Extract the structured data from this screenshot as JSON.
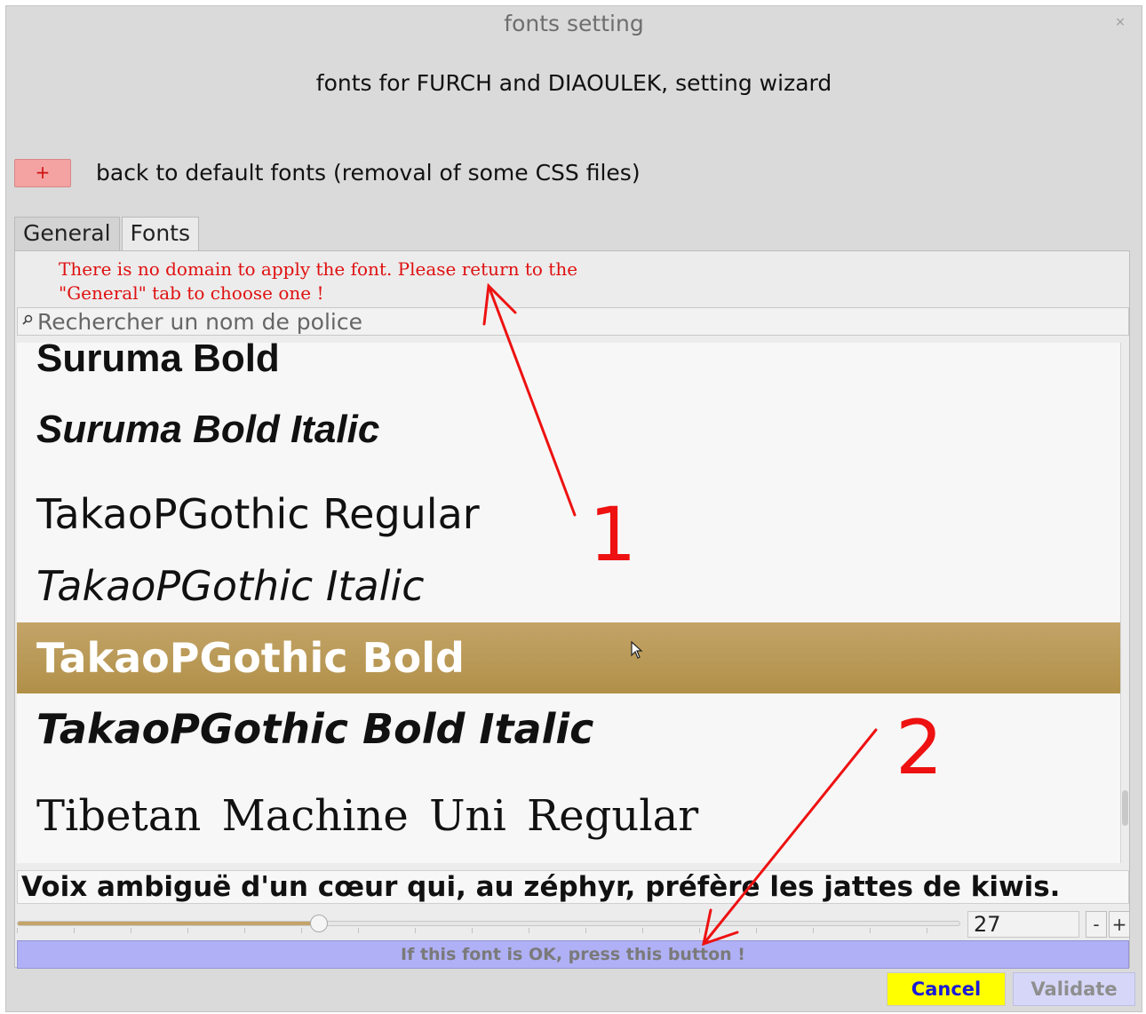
{
  "window": {
    "title": "fonts setting",
    "close_glyph": "×"
  },
  "wizard_heading": "fonts for FURCH and DIAOULEK, setting wizard",
  "reset": {
    "button_glyph": "+",
    "label": "back to default fonts (removal of some CSS files)"
  },
  "tabs": [
    {
      "label": "General",
      "active": false
    },
    {
      "label": "Fonts",
      "active": true
    }
  ],
  "warning": {
    "line1": "There is no domain to apply the font. Please return to the",
    "line2": "\"General\" tab to choose one !"
  },
  "search": {
    "icon": "search-icon",
    "placeholder": "Rechercher un nom de police",
    "value": ""
  },
  "font_list": {
    "items": [
      {
        "label": "Suruma Bold",
        "selected": false
      },
      {
        "label": "Suruma Bold Italic",
        "selected": false
      },
      {
        "label": "TakaoPGothic Regular",
        "selected": false
      },
      {
        "label": "TakaoPGothic Italic",
        "selected": false
      },
      {
        "label": "TakaoPGothic Bold",
        "selected": true
      },
      {
        "label": "TakaoPGothic Bold Italic",
        "selected": false
      },
      {
        "label": "Tibetan Machine Uni Regular",
        "selected": false
      }
    ],
    "selected_color": "#b89b58"
  },
  "preview": {
    "pangram": "Voix ambiguë d'un cœur qui, au zéphyr, préfère les jattes de kiwis."
  },
  "size_control": {
    "value": "27",
    "slider_fraction": 0.32,
    "minus_label": "-",
    "plus_label": "+"
  },
  "ok_button": {
    "label": "If this font is OK, press this button !",
    "color": "#b0b0f6"
  },
  "dialog_buttons": {
    "cancel": "Cancel",
    "validate": "Validate"
  },
  "annotations": [
    {
      "label": "1",
      "color": "#ee1111"
    },
    {
      "label": "2",
      "color": "#ee1111"
    }
  ]
}
